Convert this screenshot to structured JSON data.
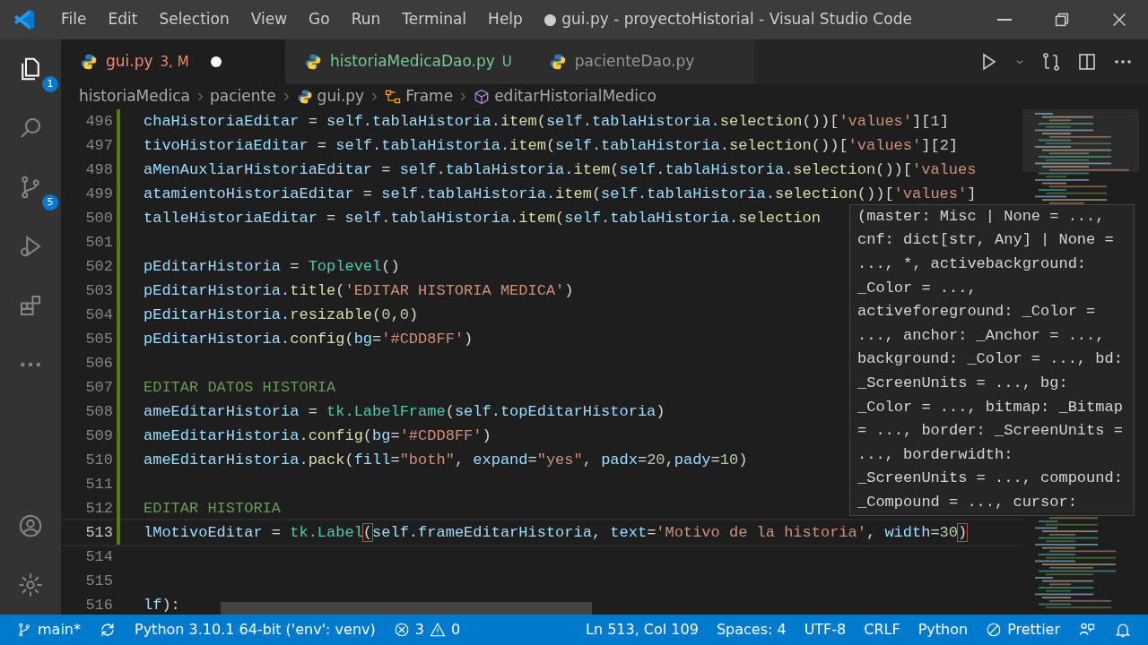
{
  "window": {
    "title": "● gui.py - proyectoHistorial - Visual Studio Code"
  },
  "menu": [
    "File",
    "Edit",
    "Selection",
    "View",
    "Go",
    "Run",
    "Terminal",
    "Help"
  ],
  "activity_bar": [
    {
      "kind": "files",
      "badge": "1",
      "selected": true
    },
    {
      "kind": "search",
      "selected": false
    },
    {
      "kind": "branch",
      "badge": "5",
      "selected": false
    },
    {
      "kind": "debug",
      "selected": false
    },
    {
      "kind": "extensions",
      "selected": false
    },
    {
      "kind": "more",
      "selected": false
    },
    {
      "kind": "account",
      "selected": false
    },
    {
      "kind": "gear",
      "selected": false
    }
  ],
  "tabs": [
    {
      "label": "gui.py",
      "decoration": "3, M",
      "kind": "modified",
      "dirty": true,
      "selected": true
    },
    {
      "label": "historiaMedicaDao.py",
      "decoration": "U",
      "kind": "untracked",
      "dirty": false,
      "selected": false
    },
    {
      "label": "pacienteDao.py",
      "kind": "plain",
      "dirty": false,
      "selected": false
    }
  ],
  "breadcrumb": [
    {
      "kind": "folder",
      "label": "historiaMedica"
    },
    {
      "kind": "folder",
      "label": "paciente"
    },
    {
      "kind": "python",
      "label": "gui.py"
    },
    {
      "kind": "class",
      "label": "Frame"
    },
    {
      "kind": "method",
      "label": "editarHistorialMedico"
    }
  ],
  "editor": {
    "lines": [
      {
        "number": "496",
        "modified": true,
        "current": false,
        "tokens": [
          {
            "kind": "var",
            "text": "chaHistoriaEditar"
          },
          {
            "kind": "op",
            "text": " = "
          },
          {
            "kind": "var",
            "text": "self.tablaHistoria."
          },
          {
            "kind": "func",
            "text": "item"
          },
          {
            "kind": "op",
            "text": "("
          },
          {
            "kind": "var",
            "text": "self.tablaHistoria."
          },
          {
            "kind": "func",
            "text": "selection"
          },
          {
            "kind": "op",
            "text": "())["
          },
          {
            "kind": "str",
            "text": "'values'"
          },
          {
            "kind": "op",
            "text": "]["
          },
          {
            "kind": "num",
            "text": "1"
          },
          {
            "kind": "op",
            "text": "]"
          }
        ]
      },
      {
        "number": "497",
        "modified": true,
        "current": false,
        "tokens": [
          {
            "kind": "var",
            "text": "tivoHistoriaEditar"
          },
          {
            "kind": "op",
            "text": " = "
          },
          {
            "kind": "var",
            "text": "self.tablaHistoria."
          },
          {
            "kind": "func",
            "text": "item"
          },
          {
            "kind": "op",
            "text": "("
          },
          {
            "kind": "var",
            "text": "self.tablaHistoria."
          },
          {
            "kind": "func",
            "text": "selection"
          },
          {
            "kind": "op",
            "text": "())["
          },
          {
            "kind": "str",
            "text": "'values'"
          },
          {
            "kind": "op",
            "text": "]["
          },
          {
            "kind": "num",
            "text": "2"
          },
          {
            "kind": "op",
            "text": "]"
          }
        ]
      },
      {
        "number": "498",
        "modified": true,
        "current": false,
        "tokens": [
          {
            "kind": "var",
            "text": "aMenAuxliarHistoriaEditar"
          },
          {
            "kind": "op",
            "text": " = "
          },
          {
            "kind": "var",
            "text": "self.tablaHistoria."
          },
          {
            "kind": "func",
            "text": "item"
          },
          {
            "kind": "op",
            "text": "("
          },
          {
            "kind": "var",
            "text": "self.tablaHistoria."
          },
          {
            "kind": "func",
            "text": "selection"
          },
          {
            "kind": "op",
            "text": "())["
          },
          {
            "kind": "str",
            "text": "'values"
          }
        ]
      },
      {
        "number": "499",
        "modified": true,
        "current": false,
        "tokens": [
          {
            "kind": "var",
            "text": "atamientoHistoriaEditar"
          },
          {
            "kind": "op",
            "text": " = "
          },
          {
            "kind": "var",
            "text": "self.tablaHistoria."
          },
          {
            "kind": "func",
            "text": "item"
          },
          {
            "kind": "op",
            "text": "("
          },
          {
            "kind": "var",
            "text": "self.tablaHistoria."
          },
          {
            "kind": "func",
            "text": "selection"
          },
          {
            "kind": "op",
            "text": "())["
          },
          {
            "kind": "str",
            "text": "'values'"
          },
          {
            "kind": "op",
            "text": "]"
          }
        ]
      },
      {
        "number": "500",
        "modified": true,
        "current": false,
        "tokens": [
          {
            "kind": "var",
            "text": "talleHistoriaEditar"
          },
          {
            "kind": "op",
            "text": " = "
          },
          {
            "kind": "var",
            "text": "self.tablaHistoria."
          },
          {
            "kind": "func",
            "text": "item"
          },
          {
            "kind": "op",
            "text": "("
          },
          {
            "kind": "var",
            "text": "self.tablaHistoria."
          },
          {
            "kind": "func",
            "text": "selection"
          }
        ]
      },
      {
        "number": "501",
        "modified": true,
        "current": false
      },
      {
        "number": "502",
        "modified": true,
        "current": false,
        "tokens": [
          {
            "kind": "var",
            "text": "pEditarHistoria"
          },
          {
            "kind": "op",
            "text": " = "
          },
          {
            "kind": "class",
            "text": "Toplevel"
          },
          {
            "kind": "op",
            "text": "()"
          }
        ]
      },
      {
        "number": "503",
        "modified": true,
        "current": false,
        "tokens": [
          {
            "kind": "var",
            "text": "pEditarHistoria."
          },
          {
            "kind": "func",
            "text": "title"
          },
          {
            "kind": "op",
            "text": "("
          },
          {
            "kind": "str",
            "text": "'EDITAR HISTORIA MEDICA'"
          },
          {
            "kind": "op",
            "text": ")"
          }
        ]
      },
      {
        "number": "504",
        "modified": true,
        "current": false,
        "tokens": [
          {
            "kind": "var",
            "text": "pEditarHistoria."
          },
          {
            "kind": "func",
            "text": "resizable"
          },
          {
            "kind": "op",
            "text": "("
          },
          {
            "kind": "num",
            "text": "0"
          },
          {
            "kind": "op",
            "text": ","
          },
          {
            "kind": "num",
            "text": "0"
          },
          {
            "kind": "op",
            "text": ")"
          }
        ]
      },
      {
        "number": "505",
        "modified": true,
        "current": false,
        "tokens": [
          {
            "kind": "var",
            "text": "pEditarHistoria."
          },
          {
            "kind": "func",
            "text": "config"
          },
          {
            "kind": "op",
            "text": "("
          },
          {
            "kind": "var",
            "text": "bg"
          },
          {
            "kind": "op",
            "text": "="
          },
          {
            "kind": "str",
            "text": "'#CDD8FF'"
          },
          {
            "kind": "op",
            "text": ")"
          }
        ]
      },
      {
        "number": "506",
        "modified": true,
        "current": false
      },
      {
        "number": "507",
        "modified": true,
        "current": false,
        "tokens": [
          {
            "kind": "comment",
            "text": "EDITAR DATOS HISTORIA"
          }
        ]
      },
      {
        "number": "508",
        "modified": true,
        "current": false,
        "tokens": [
          {
            "kind": "var",
            "text": "ameEditarHistoria"
          },
          {
            "kind": "op",
            "text": " = "
          },
          {
            "kind": "class",
            "text": "tk.LabelFrame"
          },
          {
            "kind": "op",
            "text": "("
          },
          {
            "kind": "var",
            "text": "self.topEditarHistoria"
          },
          {
            "kind": "op",
            "text": ")"
          }
        ]
      },
      {
        "number": "509",
        "modified": true,
        "current": false,
        "tokens": [
          {
            "kind": "var",
            "text": "ameEditarHistoria."
          },
          {
            "kind": "func",
            "text": "config"
          },
          {
            "kind": "op",
            "text": "("
          },
          {
            "kind": "var",
            "text": "bg"
          },
          {
            "kind": "op",
            "text": "="
          },
          {
            "kind": "str",
            "text": "'#CDD8FF'"
          },
          {
            "kind": "op",
            "text": ")"
          }
        ]
      },
      {
        "number": "510",
        "modified": true,
        "current": false,
        "tokens": [
          {
            "kind": "var",
            "text": "ameEditarHistoria."
          },
          {
            "kind": "func",
            "text": "pack"
          },
          {
            "kind": "op",
            "text": "("
          },
          {
            "kind": "var",
            "text": "fill"
          },
          {
            "kind": "op",
            "text": "="
          },
          {
            "kind": "str",
            "text": "\"both\""
          },
          {
            "kind": "op",
            "text": ", "
          },
          {
            "kind": "var",
            "text": "expand"
          },
          {
            "kind": "op",
            "text": "="
          },
          {
            "kind": "str",
            "text": "\"yes\""
          },
          {
            "kind": "op",
            "text": ", "
          },
          {
            "kind": "var",
            "text": "padx"
          },
          {
            "kind": "op",
            "text": "="
          },
          {
            "kind": "num",
            "text": "20"
          },
          {
            "kind": "op",
            "text": ","
          },
          {
            "kind": "var",
            "text": "pady"
          },
          {
            "kind": "op",
            "text": "="
          },
          {
            "kind": "num",
            "text": "10"
          },
          {
            "kind": "op",
            "text": ")"
          }
        ]
      },
      {
        "number": "511",
        "modified": true,
        "current": false
      },
      {
        "number": "512",
        "modified": true,
        "current": false,
        "tokens": [
          {
            "kind": "comment",
            "text": "EDITAR HISTORIA"
          }
        ]
      },
      {
        "number": "513",
        "modified": true,
        "current": true,
        "tokens": [
          {
            "kind": "var",
            "text": "lMotivoEditar"
          },
          {
            "kind": "op",
            "text": " = "
          },
          {
            "kind": "class",
            "text": "tk.Label"
          },
          {
            "kind": "bracket",
            "text": "("
          },
          {
            "kind": "var",
            "text": "self.frameEditarHistoria"
          },
          {
            "kind": "op",
            "text": ", "
          },
          {
            "kind": "var",
            "text": "text"
          },
          {
            "kind": "op",
            "text": "="
          },
          {
            "kind": "str",
            "text": "'Motivo de la historia'"
          },
          {
            "kind": "op",
            "text": ", "
          },
          {
            "kind": "var",
            "text": "width"
          },
          {
            "kind": "op",
            "text": "="
          },
          {
            "kind": "num",
            "text": "30"
          },
          {
            "kind": "bracket",
            "text": ")"
          }
        ]
      },
      {
        "number": "514",
        "modified": false,
        "current": false
      },
      {
        "number": "515",
        "modified": false,
        "current": false
      },
      {
        "number": "516",
        "modified": false,
        "current": false,
        "tokens": [
          {
            "kind": "var",
            "text": "lf"
          },
          {
            "kind": "op",
            "text": "):"
          }
        ]
      }
    ]
  },
  "hover": {
    "lines": [
      "(master: Misc | None = ...,",
      "cnf: dict[str, Any] | None =",
      "..., *, activebackground:",
      "_Color = ...,",
      "activeforeground: _Color =",
      "..., anchor: _Anchor = ...,",
      "background: _Color = ..., bd:",
      "_ScreenUnits = ..., bg:",
      "_Color = ..., bitmap: _Bitmap",
      "= ..., border: _ScreenUnits =",
      "..., borderwidth:",
      "_ScreenUnits = ..., compound:",
      "_Compound = ..., cursor:"
    ]
  },
  "status_bar": [
    {
      "kind": "branch",
      "label": "main*"
    },
    {
      "kind": "sync"
    },
    {
      "kind": "text",
      "label": "Python 3.10.1 64-bit ('env': venv)"
    },
    {
      "kind": "problems",
      "errors": "3",
      "warnings": "0"
    },
    {
      "kind": "spacer"
    },
    {
      "kind": "text",
      "label": "Ln 513, Col 109"
    },
    {
      "kind": "text",
      "label": "Spaces: 4"
    },
    {
      "kind": "text",
      "label": "UTF-8"
    },
    {
      "kind": "text",
      "label": "CRLF"
    },
    {
      "kind": "text",
      "label": "Python"
    },
    {
      "kind": "prettier",
      "label": "Prettier"
    },
    {
      "kind": "feedback"
    },
    {
      "kind": "bell"
    }
  ]
}
